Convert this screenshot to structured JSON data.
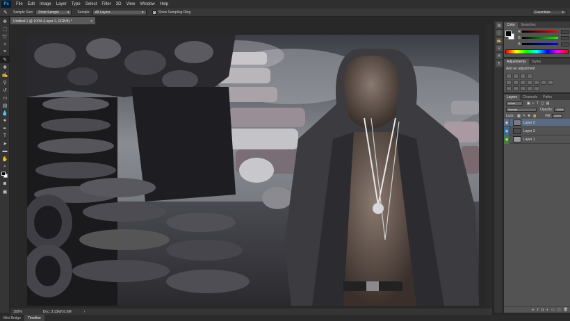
{
  "menubar": {
    "logo": "Ps",
    "items": [
      "File",
      "Edit",
      "Image",
      "Layer",
      "Type",
      "Select",
      "Filter",
      "3D",
      "View",
      "Window",
      "Help"
    ]
  },
  "options": {
    "sample_size_label": "Sample Size:",
    "sample_size_value": "Point Sample",
    "sample_label": "Sample:",
    "sample_value": "All Layers",
    "show_ring_label": "Show Sampling Ring",
    "workspace_value": "Essentials"
  },
  "document": {
    "tab_title": "Untitled-1 @ 100% (Layer 2, RGB/8) *"
  },
  "status": {
    "zoom": "100%",
    "doc_info": "Doc: 3.13M/10.8M"
  },
  "bottom_tabs": [
    "Mini Bridge",
    "Timeline"
  ],
  "color_panel": {
    "tabs": [
      "Color",
      "Swatches"
    ],
    "channels": [
      "R",
      "G",
      "B"
    ]
  },
  "adjustments_panel": {
    "tabs": [
      "Adjustments",
      "Styles"
    ],
    "title": "Add an adjustment"
  },
  "layers_panel": {
    "tabs": [
      "Layers",
      "Channels",
      "Paths"
    ],
    "filter_kind": "Kind",
    "blend_mode": "Normal",
    "opacity_label": "Opacity:",
    "opacity_value": "100%",
    "lock_label": "Lock:",
    "fill_label": "Fill:",
    "fill_value": "100%",
    "layers": [
      {
        "name": "Layer 2"
      },
      {
        "name": "Layer 3"
      },
      {
        "name": "Layer 1"
      }
    ]
  },
  "colors": {
    "accent": "#31a8ff",
    "selected_layer": "#5b6b83"
  }
}
